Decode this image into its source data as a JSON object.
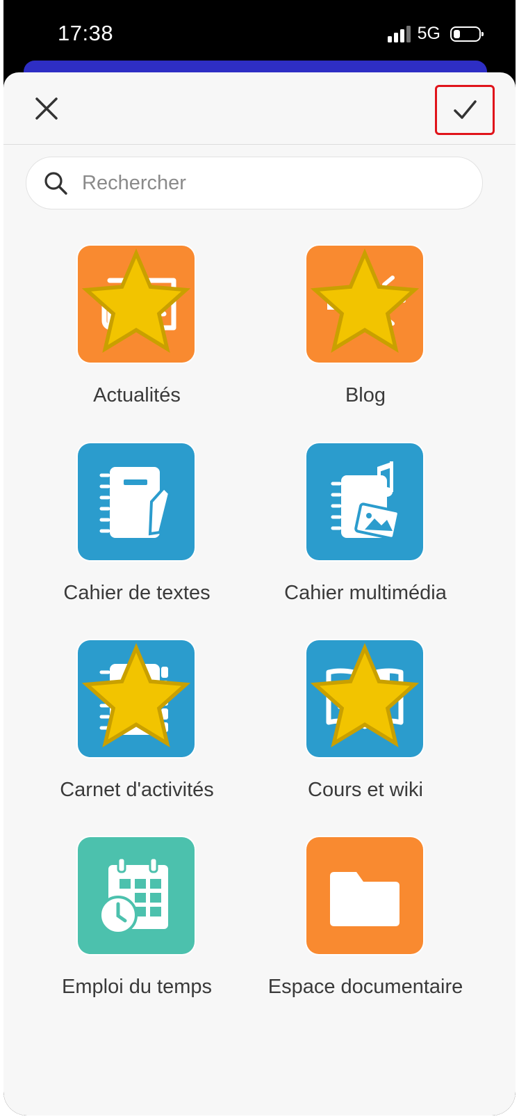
{
  "status_bar": {
    "time": "17:38",
    "network": "5G"
  },
  "header": {
    "close_icon": "close-icon",
    "confirm_icon": "check-icon"
  },
  "search": {
    "placeholder": "Rechercher",
    "value": ""
  },
  "apps": [
    {
      "label": "Actualités",
      "icon": "newspaper-icon",
      "favorite": true,
      "color": "#f98a30"
    },
    {
      "label": "Blog",
      "icon": "megaphone-icon",
      "favorite": true,
      "color": "#f98a30"
    },
    {
      "label": "Cahier de textes",
      "icon": "notebook-pen-icon",
      "favorite": false,
      "color": "#2b9ccd"
    },
    {
      "label": "Cahier multimédia",
      "icon": "notebook-media-icon",
      "favorite": false,
      "color": "#2b9ccd"
    },
    {
      "label": "Carnet d'activités",
      "icon": "tabbed-notebook-icon",
      "favorite": true,
      "color": "#2b9ccd"
    },
    {
      "label": "Cours et wiki",
      "icon": "open-book-icon",
      "favorite": true,
      "color": "#2b9ccd"
    },
    {
      "label": "Emploi du temps",
      "icon": "calendar-clock-icon",
      "favorite": false,
      "color": "#4cc1ad"
    },
    {
      "label": "Espace documentaire",
      "icon": "folder-icon",
      "favorite": false,
      "color": "#f98a30"
    }
  ],
  "colors": {
    "favorite_star": "#f2c400",
    "highlight": "#e0141b",
    "background": "#f7f7f7"
  }
}
